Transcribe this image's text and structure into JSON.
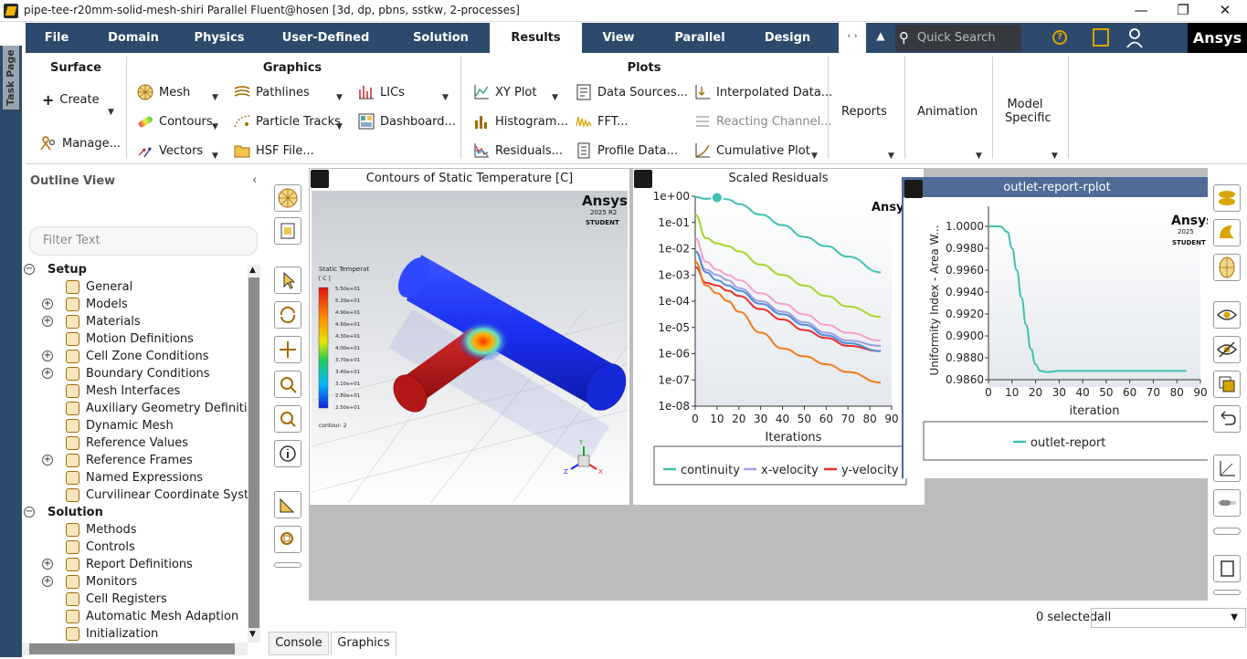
{
  "window": {
    "title": "pipe-tee-r20mm-solid-mesh-shiri Parallel Fluent@hosen  [3d, dp, pbns, sstkw, 2-processes]"
  },
  "menu": {
    "items": [
      "File",
      "Domain",
      "Physics",
      "User-Defined",
      "Solution",
      "Results",
      "View",
      "Parallel",
      "Design"
    ],
    "active": "Results",
    "search_placeholder": "Quick Search (Ctr...",
    "brand": "Ansys"
  },
  "taskpage": {
    "label": "Task Page"
  },
  "ribbon": {
    "surface": {
      "title": "Surface",
      "create": "Create",
      "manage": "Manage..."
    },
    "graphics": {
      "title": "Graphics",
      "items": [
        "Mesh",
        "Contours",
        "Vectors",
        "Pathlines",
        "Particle Tracks",
        "HSF File...",
        "LICs",
        "Dashboard..."
      ]
    },
    "plots": {
      "title": "Plots",
      "items": [
        "XY Plot",
        "Histogram...",
        "Residuals...",
        "Data Sources...",
        "FFT...",
        "Profile Data...",
        "Interpolated Data...",
        "Reacting Channel...",
        "Cumulative Plot"
      ]
    },
    "reports": "Reports",
    "animation": "Animation",
    "model_specific_1": "Model",
    "model_specific_2": "Specific"
  },
  "outline": {
    "title": "Outline View",
    "filter_placeholder": "Filter Text",
    "setup": "Setup",
    "setup_items": [
      "General",
      "Models",
      "Materials",
      "Motion Definitions",
      "Cell Zone Conditions",
      "Boundary Conditions",
      "Mesh Interfaces",
      "Auxiliary Geometry Definitions",
      "Dynamic Mesh",
      "Reference Values",
      "Reference Frames",
      "Named Expressions",
      "Curvilinear Coordinate System"
    ],
    "solution": "Solution",
    "solution_items": [
      "Methods",
      "Controls",
      "Report Definitions",
      "Monitors",
      "Cell Registers",
      "Automatic Mesh Adaption",
      "Initialization"
    ]
  },
  "contour_panel": {
    "title": "Contours of Static Temperature [C]",
    "logo": "Ansys",
    "logo_ver": "2025 R2",
    "logo_student": "STUDENT",
    "legend_title": "Static Temperat",
    "legend_unit": "[ C ]",
    "legend_values": [
      "5.50e+01",
      "5.20e+01",
      "4.90e+01",
      "4.60e+01",
      "4.30e+01",
      "4.00e+01",
      "3.70e+01",
      "3.40e+01",
      "3.10e+01",
      "2.80e+01",
      "2.50e+01"
    ],
    "legend_footer": "contour- 2"
  },
  "residuals_panel": {
    "title": "Scaled Residuals",
    "logo": "Ansys",
    "legend": [
      "continuity",
      "x-velocity",
      "y-velocity"
    ]
  },
  "report_panel": {
    "title": "outlet-report-rplot",
    "logo": "Ansys",
    "logo_ver": "2025",
    "logo_student": "STUDENT",
    "legend": [
      "outlet-report"
    ]
  },
  "chart_data": [
    {
      "type": "line",
      "title": "Scaled Residuals",
      "xlabel": "Iterations",
      "ylabel": "",
      "x_ticks": [
        "0",
        "10",
        "20",
        "30",
        "40",
        "50",
        "60",
        "70",
        "80",
        "90"
      ],
      "y_ticks": [
        "1e+00",
        "1e-01",
        "1e-02",
        "1e-03",
        "1e-04",
        "1e-05",
        "1e-06",
        "1e-07",
        "1e-08"
      ],
      "xlim": [
        0,
        90
      ],
      "ylim_log10": [
        -8,
        0
      ],
      "y_scale": "log",
      "x": [
        0,
        5,
        10,
        15,
        20,
        30,
        40,
        50,
        60,
        70,
        85
      ],
      "series": [
        {
          "name": "continuity",
          "color": "#3ec1b0",
          "log10": [
            -0.03,
            -0.1,
            -0.05,
            -0.12,
            -0.3,
            -0.7,
            -1.1,
            -1.55,
            -1.9,
            -2.3,
            -2.9
          ]
        },
        {
          "name": "x-velocity",
          "color": "#9f9fe8",
          "log10": [
            -2.1,
            -2.8,
            -3.0,
            -3.2,
            -3.5,
            -4.0,
            -4.4,
            -4.8,
            -5.2,
            -5.5,
            -5.7
          ]
        },
        {
          "name": "y-velocity",
          "color": "#e8302a",
          "log10": [
            -2.7,
            -3.3,
            -3.4,
            -3.6,
            -3.8,
            -4.3,
            -4.7,
            -5.1,
            -5.4,
            -5.7,
            -5.9
          ]
        },
        {
          "name": "",
          "color": "#a4d52a",
          "log10": [
            -0.7,
            -1.6,
            -1.8,
            -1.9,
            -2.1,
            -2.6,
            -3.0,
            -3.4,
            -3.8,
            -4.2,
            -4.6
          ]
        },
        {
          "name": "",
          "color": "#f7a0c8",
          "log10": [
            -1.6,
            -2.5,
            -2.8,
            -3.0,
            -3.2,
            -3.7,
            -4.1,
            -4.5,
            -4.9,
            -5.2,
            -5.5
          ]
        },
        {
          "name": "",
          "color": "#4f8fd8",
          "log10": [
            -2.1,
            -2.9,
            -3.2,
            -3.4,
            -3.6,
            -4.1,
            -4.5,
            -4.9,
            -5.3,
            -5.6,
            -5.9
          ]
        },
        {
          "name": "",
          "color": "#f27c1c",
          "log10": [
            -2.5,
            -3.4,
            -3.7,
            -4.0,
            -4.4,
            -5.2,
            -5.8,
            -6.1,
            -6.4,
            -6.7,
            -7.1
          ]
        }
      ]
    },
    {
      "type": "line",
      "title": "outlet-report-rplot",
      "xlabel": "iteration",
      "ylabel": "Uniformity Index - Area W...",
      "x_ticks": [
        "0",
        "10",
        "20",
        "30",
        "40",
        "50",
        "60",
        "70",
        "80",
        "90"
      ],
      "y_ticks": [
        "1.0000",
        "0.9980",
        "0.9960",
        "0.9940",
        "0.9920",
        "0.9900",
        "0.9880",
        "0.9860"
      ],
      "xlim": [
        0,
        90
      ],
      "ylim": [
        0.986,
        1.0
      ],
      "series": [
        {
          "name": "outlet-report",
          "color": "#3ec1b0",
          "x": [
            0,
            5,
            8,
            10,
            12,
            14,
            16,
            18,
            20,
            22,
            25,
            30,
            40,
            50,
            60,
            70,
            80,
            84
          ],
          "y": [
            1.0,
            1.0,
            0.9995,
            0.998,
            0.996,
            0.9935,
            0.991,
            0.9888,
            0.9874,
            0.9868,
            0.9867,
            0.9868,
            0.9868,
            0.9868,
            0.9868,
            0.9868,
            0.9868,
            0.9868
          ]
        }
      ]
    }
  ],
  "bottom": {
    "tabs": [
      "Console",
      "Graphics"
    ],
    "active_tab": "Graphics",
    "selected_label": "0 selected",
    "filter_value": "all"
  }
}
